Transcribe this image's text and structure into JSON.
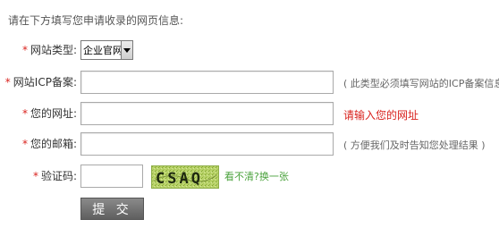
{
  "intro": "请在下方填写您申请收录的网页信息:",
  "form": {
    "required_mark": "*",
    "site_type": {
      "label": "网站类型:",
      "selected": "企业官网"
    },
    "icp": {
      "label": "网站ICP备案:",
      "value": "",
      "hint": "( 此类型必须填写网站的ICP备案信息 )"
    },
    "url": {
      "label": "您的网址:",
      "value": "",
      "error": "请输入您的网址"
    },
    "email": {
      "label": "您的邮箱:",
      "value": "",
      "hint": "( 方便我们及时告知您处理结果 )"
    },
    "captcha": {
      "label": "验证码:",
      "value": "",
      "image_text": "CSAQ",
      "refresh_link": "看不清?换一张"
    },
    "submit_label": "提 交"
  },
  "colors": {
    "required": "#d9231e",
    "error": "#d9231e",
    "link": "#4aa23c",
    "button": "#6f6f6f"
  }
}
